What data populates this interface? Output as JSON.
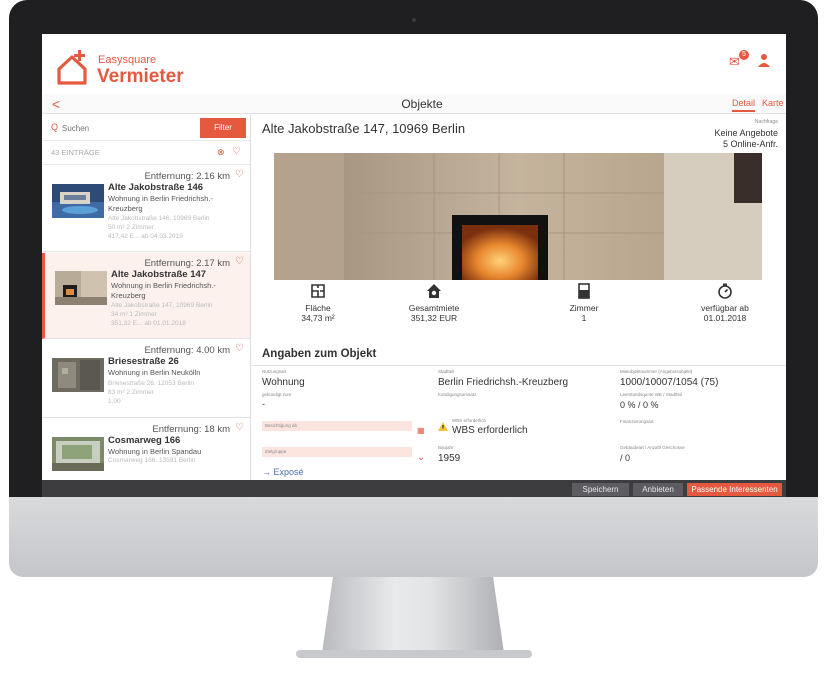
{
  "colors": {
    "accent": "#e4593f",
    "bottom_bar": "#3d3d40",
    "link": "#4a6fb5"
  },
  "header": {
    "brand_small": "Easysquare",
    "brand_big": "Vermieter",
    "mail_badge": "5"
  },
  "titlebar": {
    "back": "<",
    "title": "Objekte",
    "tab_detail": "Detail",
    "tab_karte": "Karte"
  },
  "search": {
    "placeholder": "Suchen",
    "filter_label": "Filter",
    "count": "43 EINTRÄGE"
  },
  "listings": [
    {
      "distance": "Entfernung: 2.16 km",
      "name": "Alte Jakobstraße 146",
      "type": "Wohnung in Berlin Friedrichsh.-Kreuzberg",
      "address": "Alte Jakobstraße 146, 10969 Berlin",
      "meta": "50 m²    2 Zimmer",
      "meta2": "417,42 E... ab 04.03.2019"
    },
    {
      "distance": "Entfernung: 2.17 km",
      "name": "Alte Jakobstraße 147",
      "type": "Wohnung in Berlin Friedrichsh.-Kreuzberg",
      "address": "Alte Jakobstraße 147, 10969 Berlin",
      "meta": "34 m²    1 Zimmer",
      "meta2": "351,32 E... ab 01.01.2018"
    },
    {
      "distance": "Entfernung: 4.00 km",
      "name": "Briesestraße 26",
      "type": "Wohnung in Berlin Neukölln",
      "address": "Briesestraße 26, 12053 Berlin",
      "meta": "83 m²    2 Zimmer",
      "meta2": "1,00"
    },
    {
      "distance": "Entfernung: 18 km",
      "name": "Cosmarweg 166",
      "type": "Wohnung in Berlin Spandau",
      "address": "Cosmarweg 166, 13591 Berlin",
      "meta": "",
      "meta2": ""
    }
  ],
  "detail": {
    "address": "Alte Jakobstraße 147, 10969 Berlin",
    "nachfrage_label": "Nachfrage",
    "offers": "Keine Angebote",
    "online": "5 Online-Anfr.",
    "stats": [
      {
        "icon": "floorplan-icon",
        "label": "Fläche",
        "value": "34,73 m²"
      },
      {
        "icon": "house-icon",
        "label": "Gesamtmiete",
        "value": "351,32 EUR"
      },
      {
        "icon": "door-icon",
        "label": "Zimmer",
        "value": "1"
      },
      {
        "icon": "stopwatch-icon",
        "label": "verfügbar ab",
        "value": "01.01.2018"
      }
    ],
    "section_title": "Angaben zum Objekt",
    "fields": {
      "nutzungsart_label": "Nutzungsart",
      "nutzungsart_value": "Wohnung",
      "stadtteil_label": "Stadtteil",
      "stadtteil_value": "Berlin Friedrichsh.-Kreuzberg",
      "mietobjekt_label": "Mietobjektnummer (Angebotsobjekt)",
      "mietobjekt_value": "1000/10007/1054 (75)",
      "gekuendigt_label": "gekündigt zum",
      "gekuendigt_value": "-",
      "kuendigung_label": "Kündigungsumsatz",
      "leerstand_label": "Leerstandsquote WE / Stadtteil",
      "leerstand_value": "0 % / 0 %",
      "besichtigung_placeholder": "Besichtigung ab",
      "wbs_label": "WBS erforderlich",
      "wbs_value": "WBS erforderlich",
      "finanzierung_label": "Finanzierungsart",
      "zielgruppe_placeholder": "Zielgruppe",
      "baujahr_label": "Baujahr",
      "baujahr_value": "1959",
      "gebaeude_label": "Gebäudeart / Anzahl Geschosse",
      "gebaeude_value": "/ 0",
      "expose": "→  Exposé"
    }
  },
  "actions": {
    "speichern": "Speichern",
    "anbieten": "Anbieten",
    "passende": "Passende Interessenten"
  }
}
